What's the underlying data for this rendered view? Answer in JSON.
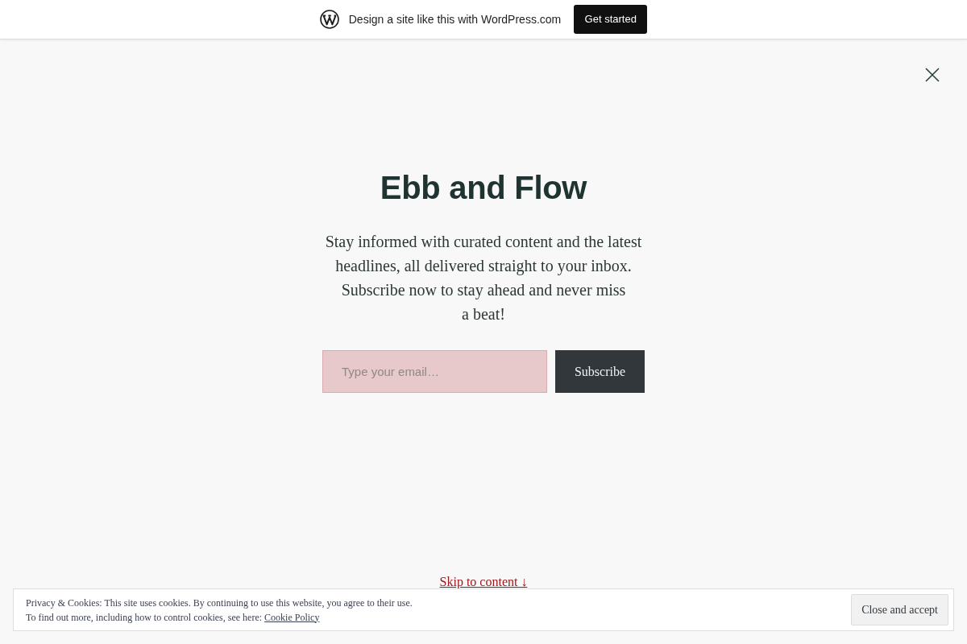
{
  "top_bar": {
    "message": "Design a site like this with WordPress.com",
    "button": "Get started"
  },
  "title": "Ebb and Flow",
  "description": "Stay informed with curated content and the latest headlines, all delivered straight to your inbox. Subscribe now to stay ahead and never miss a beat!",
  "subscribe_form": {
    "placeholder": "Type your email…",
    "button": "Subscribe"
  },
  "skip_link": "Skip to content ↓",
  "cookie_banner": {
    "notice": "Privacy & Cookies: This site uses cookies. By continuing to use this website, you agree to their use.",
    "more_info": "To find out more, including how to control cookies, see here:",
    "link": "Cookie Policy",
    "button": "Close and accept"
  }
}
